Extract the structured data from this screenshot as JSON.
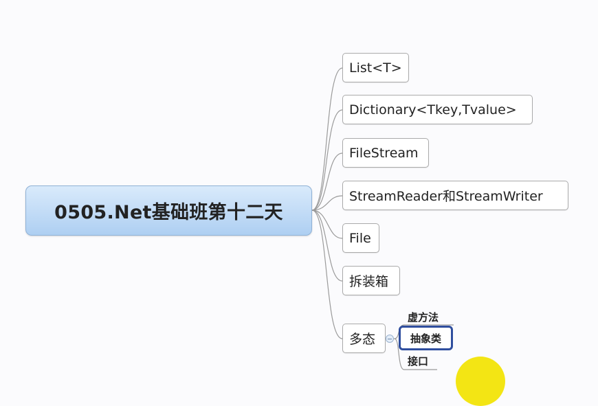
{
  "root": {
    "label": "0505.Net基础班第十二天"
  },
  "topics": [
    {
      "label": "List<T>"
    },
    {
      "label": "Dictionary<Tkey,Tvalue>"
    },
    {
      "label": "FileStream"
    },
    {
      "label": "StreamReader和StreamWriter"
    },
    {
      "label": "File"
    },
    {
      "label": "拆装箱"
    },
    {
      "label": "多态"
    }
  ],
  "polymorphism_subtopics": [
    {
      "label": "虚方法"
    },
    {
      "label": "抽象类",
      "selected": true
    },
    {
      "label": "接口"
    }
  ],
  "colors": {
    "root_fill": "#aecff2",
    "selection_border": "#2f4e9e",
    "connector": "#999999",
    "cursor_highlight": "#f2e300"
  }
}
